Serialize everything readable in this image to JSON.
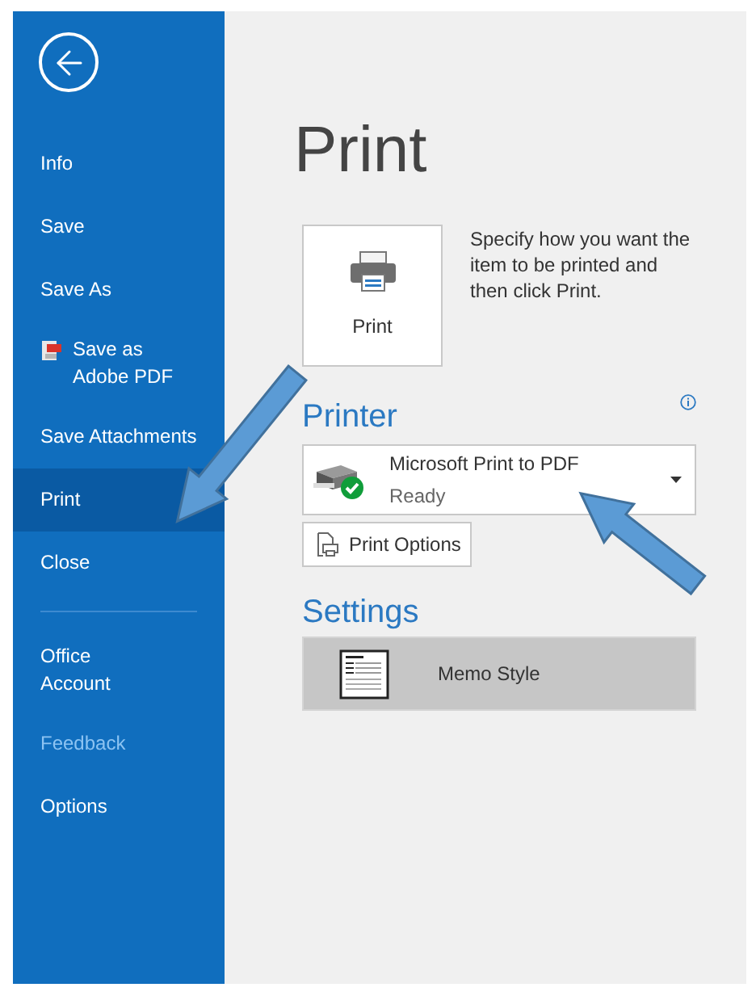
{
  "sidebar": {
    "items": [
      {
        "label": "Info",
        "kind": "plain",
        "selected": false,
        "disabled": false,
        "divider_before": false
      },
      {
        "label": "Save",
        "kind": "plain",
        "selected": false,
        "disabled": false,
        "divider_before": false
      },
      {
        "label": "Save As",
        "kind": "plain",
        "selected": false,
        "disabled": false,
        "divider_before": false
      },
      {
        "label": "Save as\nAdobe PDF",
        "kind": "pdf",
        "selected": false,
        "disabled": false,
        "divider_before": false
      },
      {
        "label": "Save Attachments",
        "kind": "plain",
        "selected": false,
        "disabled": false,
        "divider_before": false
      },
      {
        "label": "Print",
        "kind": "plain",
        "selected": true,
        "disabled": false,
        "divider_before": false
      },
      {
        "label": "Close",
        "kind": "plain",
        "selected": false,
        "disabled": false,
        "divider_before": false
      },
      {
        "label": "Office\nAccount",
        "kind": "plain",
        "selected": false,
        "disabled": false,
        "divider_before": true
      },
      {
        "label": "Feedback",
        "kind": "plain",
        "selected": false,
        "disabled": true,
        "divider_before": false
      },
      {
        "label": "Options",
        "kind": "plain",
        "selected": false,
        "disabled": false,
        "divider_before": false
      }
    ]
  },
  "main": {
    "title": "Print",
    "print_button": {
      "label": "Print"
    },
    "description": "Specify how you want the item to be printed and then click Print.",
    "printer": {
      "heading": "Printer",
      "name": "Microsoft Print to PDF",
      "status": "Ready"
    },
    "print_options_button": {
      "label": "Print Options"
    },
    "settings": {
      "heading": "Settings",
      "style": "Memo Style"
    }
  }
}
